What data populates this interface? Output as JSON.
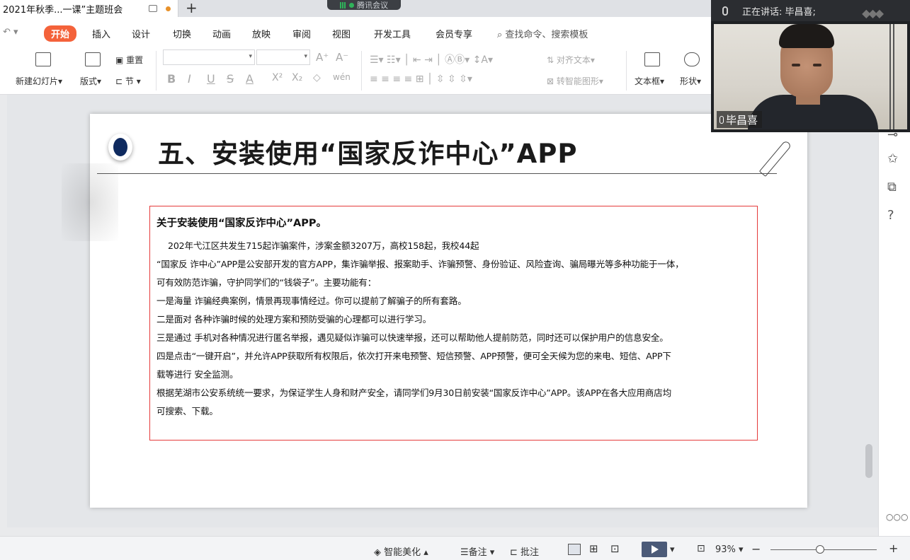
{
  "titlebar": {
    "tab_title": "2021年秋季...一课”主题班会",
    "new_tab": "+",
    "meeting_label": "腾讯会议"
  },
  "menu": {
    "undo": "↶  ▾",
    "items": [
      "开始",
      "插入",
      "设计",
      "切换",
      "动画",
      "放映",
      "审阅",
      "视图",
      "开发工具",
      "会员专享"
    ],
    "search": "查找命令、搜索模板"
  },
  "ribbon": {
    "new_slide": "新建幻灯片",
    "layout": "版式",
    "reset": "重置",
    "section": "节",
    "format_row": [
      "B",
      "I",
      "U",
      "S",
      "A",
      "X²",
      "X₂",
      "◇",
      "wén"
    ],
    "font_grow": "A⁺",
    "font_shrink": "A⁻",
    "align_text": "对齐文本",
    "smart_shape": "转智能图形",
    "textbox": "文本框",
    "shape": "形状"
  },
  "video": {
    "speaking_label": "正在讲话: 毕昌喜;",
    "participant_name": "毕昌喜"
  },
  "slide": {
    "title": "五、安装使用“国家反诈中心”APP",
    "content_heading": "关于安装使用“国家反诈中心”APP。",
    "paragraphs": [
      "202年弋江区共发生715起诈骗案件，涉案金额3207万，高校158起，我校44起",
      "“国家反 诈中心”APP是公安部开发的官方APP，集诈骗举报、报案助手、诈骗预警、身份验证、风险查询、骗局曝光等多种功能于一体，",
      "可有效防范诈骗，守护同学们的“钱袋子”。主要功能有：",
      "一是海量 诈骗经典案例，情景再现事情经过。你可以提前了解骗子的所有套路。",
      "二是面对 各种诈骗时候的处理方案和预防受骗的心理都可以进行学习。",
      "三是通过 手机对各种情况进行匿名举报，遇见疑似诈骗可以快速举报，还可以帮助他人提前防范，同时还可以保护用户的信息安全。",
      "四是点击“一键开启”，并允许APP获取所有权限后，依次打开来电预警、短信预警、APP预警，便可全天候为您的来电、短信、APP下",
      "载等进行 安全监测。",
      "根据芜湖市公安系统统一要求，为保证学生人身和财产安全，请同学们9月30日前安装“国家反诈中心”APP。该APP在各大应用商店均",
      "可搜索、下载。"
    ]
  },
  "statusbar": {
    "smart_beautify": "智能美化",
    "notes": "备注",
    "comments": "批注",
    "zoom": "93%",
    "zoom_out": "−",
    "zoom_in": "+"
  },
  "colors": {
    "accent": "#f4623a",
    "content_border": "#e53b3b",
    "bullet": "#0f2a5f"
  }
}
